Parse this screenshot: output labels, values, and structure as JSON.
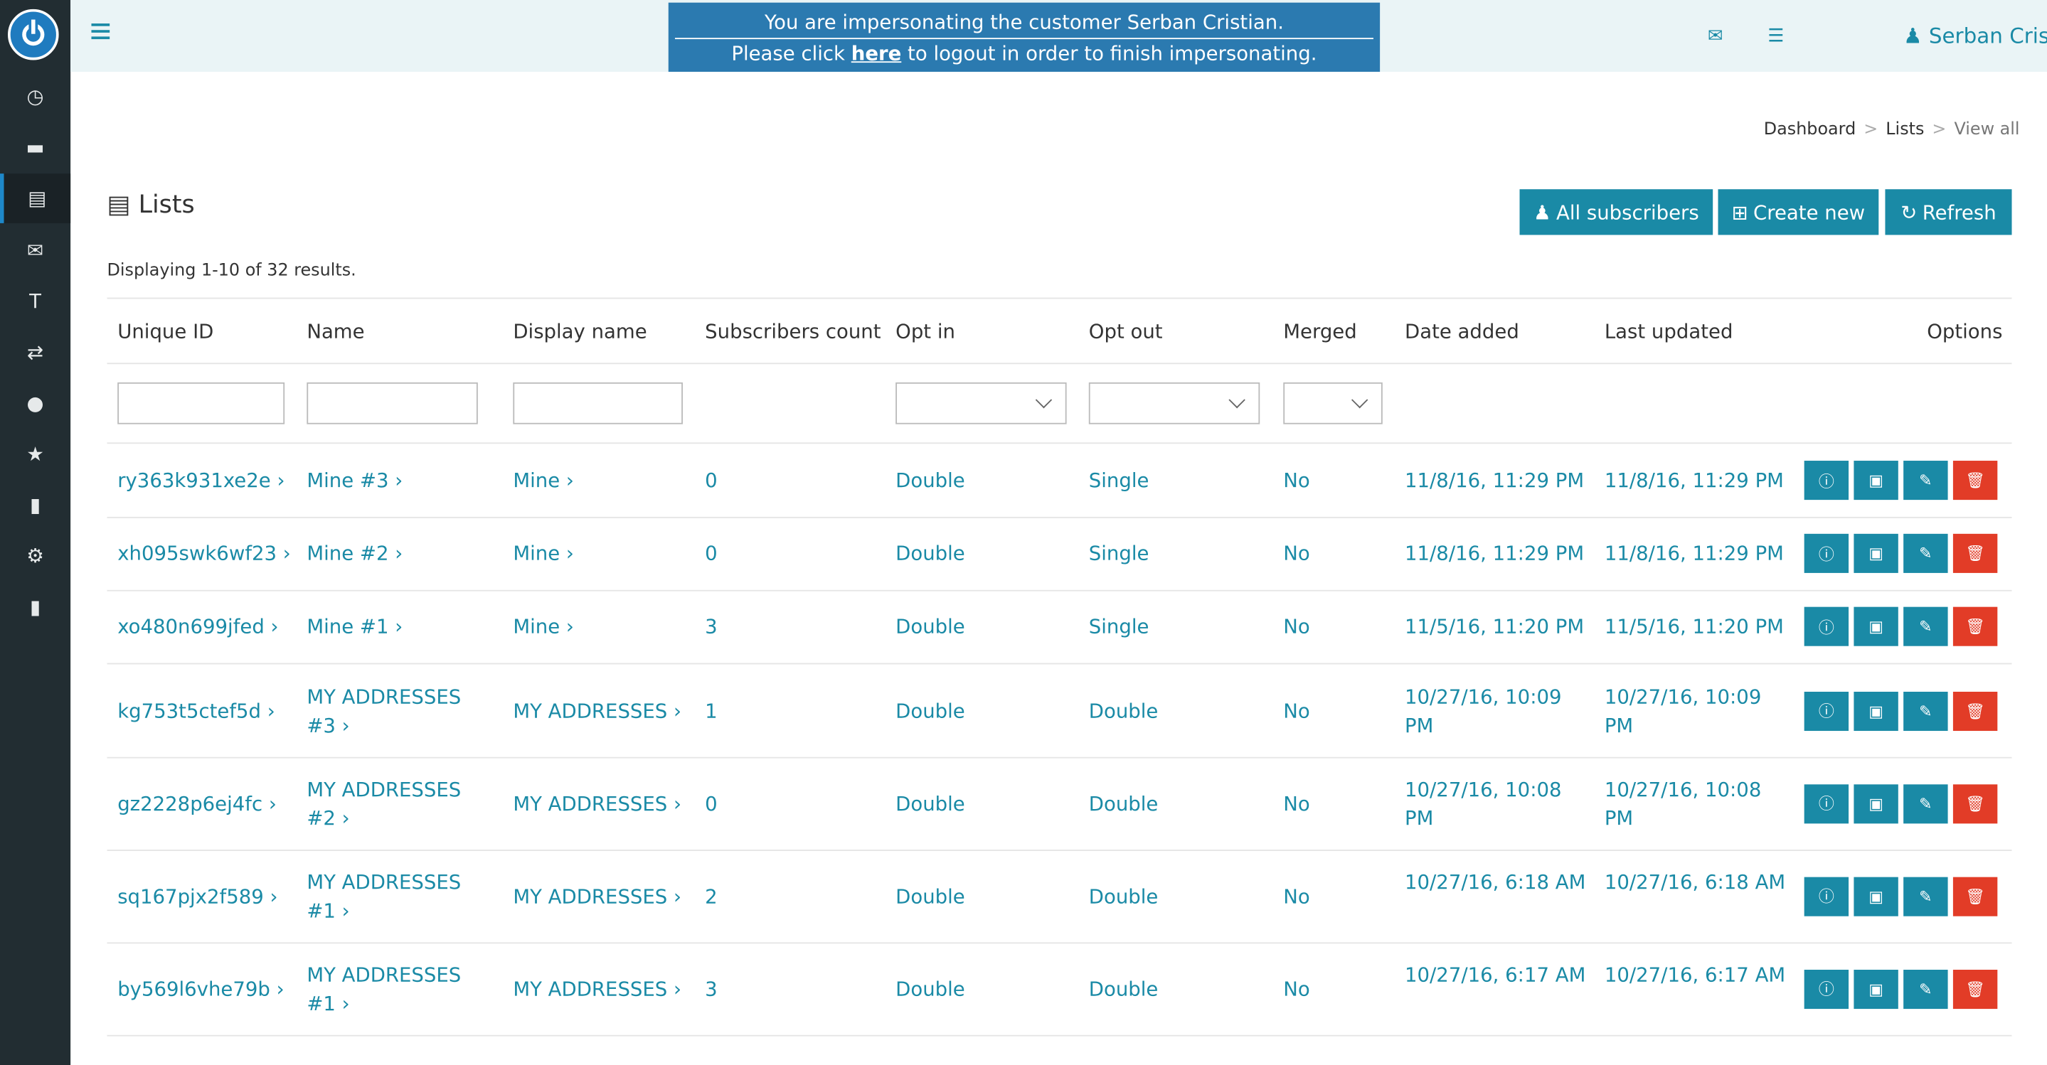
{
  "banner": {
    "line1": "You are impersonating the customer Serban Cristian.",
    "line2_pre": "Please click ",
    "line2_link": "here",
    "line2_post": " to logout in order to finish impersonating."
  },
  "user": {
    "name": "Serban Cristian"
  },
  "breadcrumb": {
    "dashboard": "Dashboard",
    "lists": "Lists",
    "current": "View all"
  },
  "page": {
    "title": "Lists",
    "summary": "Displaying 1-10 of 32 results."
  },
  "buttons": {
    "all_subscribers": "All subscribers",
    "create_new": "Create new",
    "refresh": "Refresh"
  },
  "columns": [
    "Unique ID",
    "Name",
    "Display name",
    "Subscribers count",
    "Opt in",
    "Opt out",
    "Merged",
    "Date added",
    "Last updated",
    "Options"
  ],
  "rows": [
    {
      "uid": "ry363k931xe2e ›",
      "name": "Mine #3 ›",
      "display": "Mine ›",
      "count": "0",
      "optin": "Double",
      "optout": "Single",
      "merged": "No",
      "added": "11/8/16, 11:29 PM",
      "updated": "11/8/16, 11:29 PM"
    },
    {
      "uid": "xh095swk6wf23 ›",
      "name": "Mine #2 ›",
      "display": "Mine ›",
      "count": "0",
      "optin": "Double",
      "optout": "Single",
      "merged": "No",
      "added": "11/8/16, 11:29 PM",
      "updated": "11/8/16, 11:29 PM"
    },
    {
      "uid": "xo480n699jfed ›",
      "name": "Mine #1 ›",
      "display": "Mine ›",
      "count": "3",
      "optin": "Double",
      "optout": "Single",
      "merged": "No",
      "added": "11/5/16, 11:20 PM",
      "updated": "11/5/16, 11:20 PM"
    },
    {
      "uid": "kg753t5ctef5d ›",
      "name": "MY ADDRESSES #3 ›",
      "display": "MY ADDRESSES ›",
      "count": "1",
      "optin": "Double",
      "optout": "Double",
      "merged": "No",
      "added": "10/27/16, 10:09 PM",
      "updated": "10/27/16, 10:09 PM"
    },
    {
      "uid": "gz2228p6ej4fc ›",
      "name": "MY ADDRESSES #2 ›",
      "display": "MY ADDRESSES ›",
      "count": "0",
      "optin": "Double",
      "optout": "Double",
      "merged": "No",
      "added": "10/27/16, 10:08 PM",
      "updated": "10/27/16, 10:08 PM"
    },
    {
      "uid": "sq167pjx2f589 ›",
      "name": "MY ADDRESSES #1 ›",
      "display": "MY ADDRESSES ›",
      "count": "2",
      "optin": "Double",
      "optout": "Double",
      "merged": "No",
      "added": "10/27/16, 6:18 AM",
      "updated": "10/27/16, 6:18 AM"
    },
    {
      "uid": "by569l6vhe79b ›",
      "name": "MY ADDRESSES #1 ›",
      "display": "MY ADDRESSES ›",
      "count": "3",
      "optin": "Double",
      "optout": "Double",
      "merged": "No",
      "added": "10/27/16, 6:17 AM",
      "updated": "10/27/16, 6:17 AM"
    }
  ],
  "icons": {
    "sidebar": [
      "dashboard-icon",
      "card-icon",
      "list-icon",
      "mail-icon",
      "text-icon",
      "transfer-icon",
      "globe-icon",
      "star-icon",
      "book-icon",
      "gear-icon",
      "book-icon"
    ],
    "row_actions": [
      "info-icon",
      "copy-icon",
      "edit-icon",
      "delete-icon"
    ]
  },
  "colors": {
    "accent": "#1a8aa6",
    "danger": "#e23c27",
    "sidebar": "#222d32",
    "banner": "#2b7ab0"
  }
}
